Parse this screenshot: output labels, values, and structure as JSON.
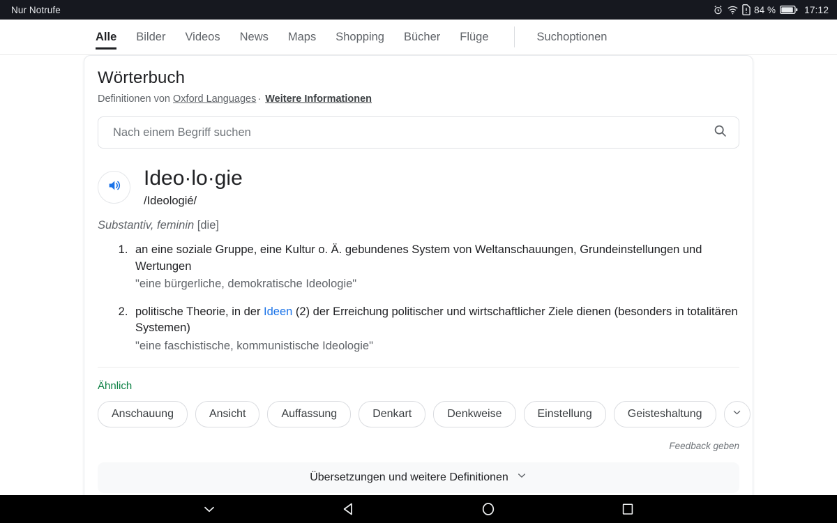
{
  "status_bar": {
    "carrier_text": "Nur Notrufe",
    "battery_percent": "84 %",
    "clock": "17:12",
    "icons": [
      "alarm-icon",
      "wifi-icon",
      "sim-warning-icon",
      "battery-icon"
    ]
  },
  "nav_tabs": {
    "items": [
      {
        "label": "Alle",
        "active": true
      },
      {
        "label": "Bilder",
        "active": false
      },
      {
        "label": "Videos",
        "active": false
      },
      {
        "label": "News",
        "active": false
      },
      {
        "label": "Maps",
        "active": false
      },
      {
        "label": "Shopping",
        "active": false
      },
      {
        "label": "Bücher",
        "active": false
      },
      {
        "label": "Flüge",
        "active": false
      }
    ],
    "options_label": "Suchoptionen"
  },
  "dictionary": {
    "title": "Wörterbuch",
    "source_prefix": "Definitionen von",
    "source_name": "Oxford Languages",
    "separator": "·",
    "more_info": "Weitere Informationen",
    "search": {
      "placeholder": "Nach einem Begriff suchen",
      "value": "",
      "icon": "search-icon"
    },
    "entry": {
      "headword": "Ideo·lo·gie",
      "phonetic": "/Ideologié/",
      "part_of_speech": "Substantiv, feminin",
      "article": "[die]",
      "audio_icon": "speaker-icon",
      "definitions": [
        {
          "number": "1.",
          "text_before_link": "an eine soziale Gruppe, eine Kultur o. Ä. gebundenes System von Weltanschauungen, Grundeinstellungen und Wertungen",
          "link": "",
          "text_after_link": "",
          "example": "\"eine bürgerliche, demokratische Ideologie\""
        },
        {
          "number": "2.",
          "text_before_link": "politische Theorie, in der ",
          "link": "Ideen",
          "text_after_link": " (2) der Erreichung politischer und wirtschaftlicher Ziele dienen (besonders in totalitären Systemen)",
          "example": "\"eine faschistische, kommunistische Ideologie\""
        }
      ]
    },
    "similar": {
      "label": "Ähnlich",
      "chips": [
        "Anschauung",
        "Ansicht",
        "Auffassung",
        "Denkart",
        "Denkweise",
        "Einstellung",
        "Geisteshaltung"
      ],
      "more_icon": "chevron-down-icon"
    },
    "feedback_label": "Feedback geben",
    "expander": {
      "label": "Übersetzungen und weitere Definitionen",
      "icon": "chevron-down-icon"
    }
  },
  "android_nav": {
    "buttons": [
      "hide-keyboard-icon",
      "back-icon",
      "home-icon",
      "recents-icon"
    ]
  },
  "colors": {
    "link_blue": "#1a73e8",
    "similar_green": "#0b8043",
    "status_bar_bg": "#16181f",
    "nav_bar_bg": "#000000"
  }
}
